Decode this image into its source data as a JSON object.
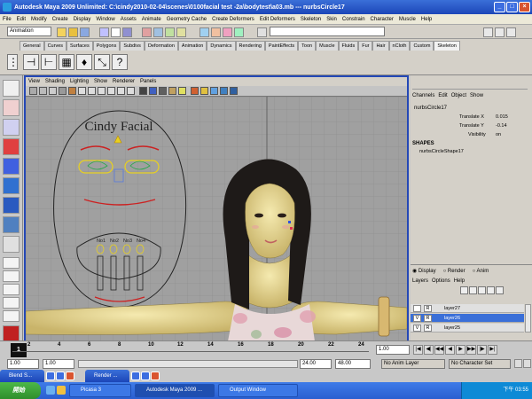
{
  "window": {
    "title": "Autodesk Maya 2009 Unlimited: C:\\cindy2010-02-04\\scenes\\0100facial test -2a\\bodytest\\a03.mb  ---  nurbsCircle17"
  },
  "menubar": [
    "File",
    "Edit",
    "Modify",
    "Create",
    "Display",
    "Window",
    "Assets",
    "Animate",
    "Geometry Cache",
    "Create Deformers",
    "Edit Deformers",
    "Skeleton",
    "Skin",
    "Constrain",
    "Character",
    "Muscle",
    "Help"
  ],
  "status": {
    "menuset": "Animation"
  },
  "shelf_tabs": [
    "General",
    "Curves",
    "Surfaces",
    "Polygons",
    "Subdivs",
    "Deformation",
    "Animation",
    "Dynamics",
    "Rendering",
    "PaintEffects",
    "Toon",
    "Muscle",
    "Fluids",
    "Fur",
    "Hair",
    "nCloth",
    "Custom",
    "Skeleton"
  ],
  "shelf_active": "Skeleton",
  "panel_menu": [
    "View",
    "Shading",
    "Lighting",
    "Show",
    "Renderer",
    "Panels"
  ],
  "viewport": {
    "facial_title": "Cindy Facial",
    "mouth_labels": [
      "No1",
      "No2",
      "No3",
      "No4"
    ]
  },
  "channel_box": {
    "menu": [
      "Channels",
      "Edit",
      "Object",
      "Show"
    ],
    "object_name": "nurbsCircle17",
    "attrs": [
      {
        "name": "Translate X",
        "value": "0.015"
      },
      {
        "name": "Translate Y",
        "value": "-0.14"
      },
      {
        "name": "Visibility",
        "value": "on"
      }
    ],
    "shapes_label": "SHAPES",
    "shape_name": "nurbsCircleShape17"
  },
  "layers": {
    "modes": [
      "Display",
      "Render",
      "Anim"
    ],
    "menu": [
      "Layers",
      "Options",
      "Help"
    ],
    "rows": [
      {
        "v": "",
        "r": "R",
        "name": "layer27",
        "selected": false
      },
      {
        "v": "V",
        "r": "R",
        "name": "layer26",
        "selected": true
      },
      {
        "v": "V",
        "r": "R",
        "name": "layer25",
        "selected": false
      }
    ]
  },
  "timeline": {
    "ticks": [
      "1",
      "2",
      "4",
      "6",
      "8",
      "10",
      "12",
      "14",
      "16",
      "18",
      "20",
      "22",
      "24"
    ],
    "current": "1.00"
  },
  "range": {
    "start": "1.00",
    "inner_start": "1.00",
    "inner_end": "24.00",
    "end": "48.00",
    "anim_layer": "No Anim Layer",
    "char_set": "No Character Set"
  },
  "minimized": [
    "Blend S...",
    "Render ..."
  ],
  "taskbar": {
    "start_label": "開始",
    "tasks": [
      "Picasa 3",
      "Autodesk Maya 2009 ...",
      "Output Window"
    ],
    "clock": "下午 03:55"
  },
  "colors": {
    "selection": "#3a6fd8",
    "panel_border": "#2448b6",
    "face_red": "#cc2222",
    "face_yellow": "#e8d020",
    "face_green": "#22aa44"
  }
}
